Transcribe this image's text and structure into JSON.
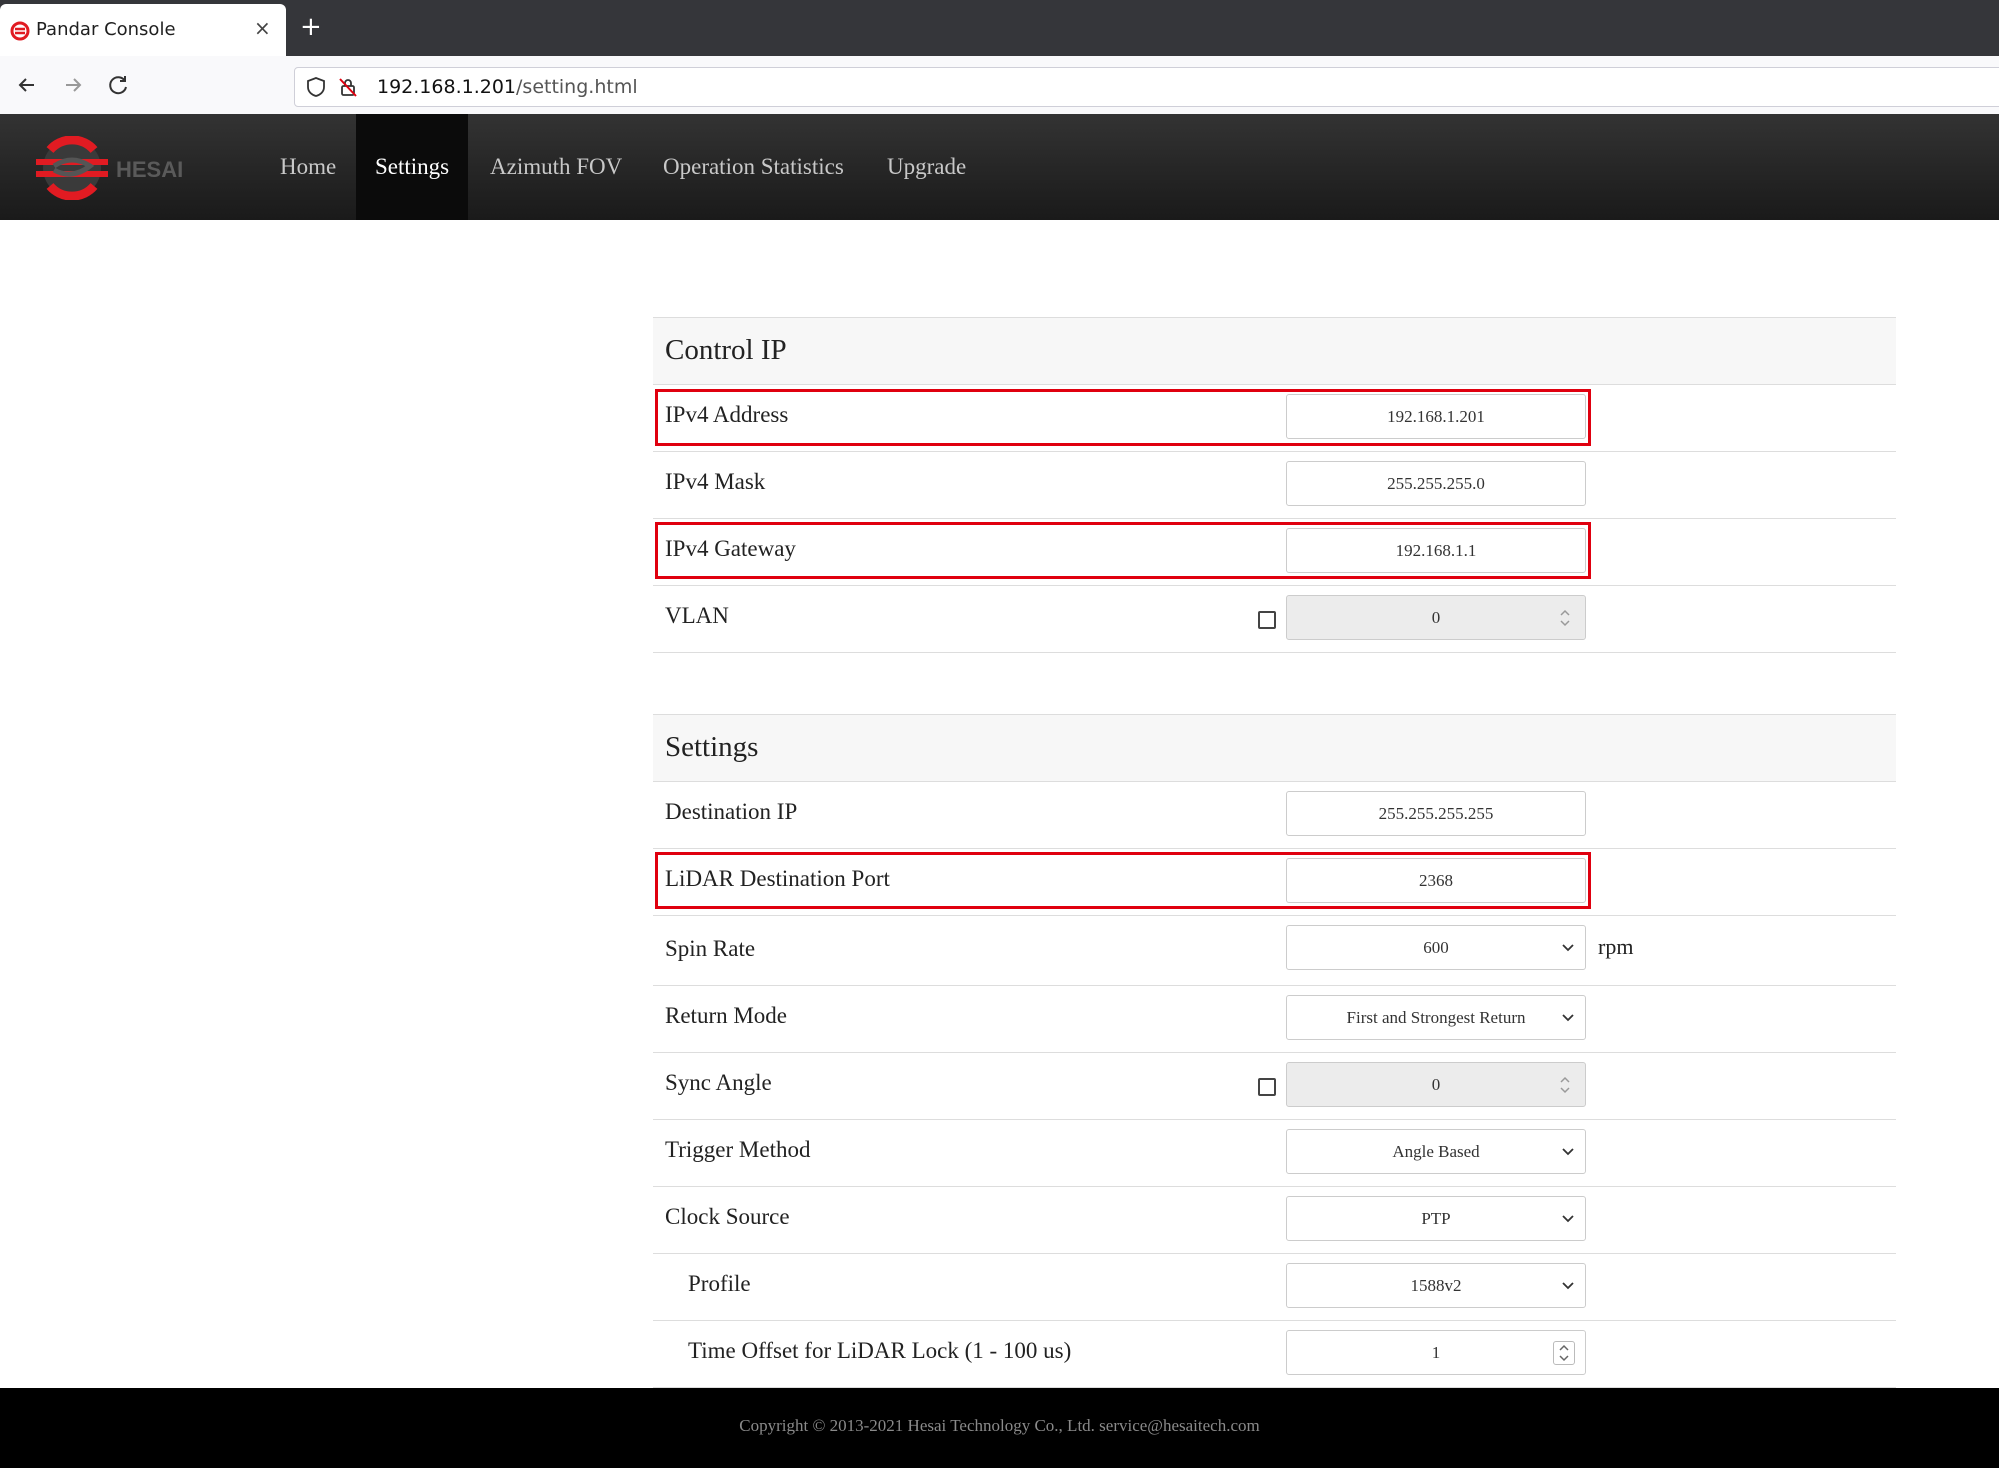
{
  "browser": {
    "tab_title": "Pandar Console",
    "close_glyph": "×",
    "new_tab_glyph": "+",
    "url_host": "192.168.1.201",
    "url_path": "/setting.html"
  },
  "header": {
    "logo_text": "HESAI",
    "menu": [
      {
        "label": "Home",
        "active": false
      },
      {
        "label": "Settings",
        "active": true
      },
      {
        "label": "Azimuth FOV",
        "active": false
      },
      {
        "label": "Operation Statistics",
        "active": false
      },
      {
        "label": "Upgrade",
        "active": false
      }
    ]
  },
  "control_ip": {
    "title": "Control IP",
    "ipv4_address": {
      "label": "IPv4 Address",
      "value": "192.168.1.201"
    },
    "ipv4_mask": {
      "label": "IPv4 Mask",
      "value": "255.255.255.0"
    },
    "ipv4_gateway": {
      "label": "IPv4 Gateway",
      "value": "192.168.1.1"
    },
    "vlan": {
      "label": "VLAN",
      "value": "0",
      "enabled": false
    }
  },
  "settings": {
    "title": "Settings",
    "destination_ip": {
      "label": "Destination IP",
      "value": "255.255.255.255"
    },
    "lidar_port": {
      "label": "LiDAR Destination Port",
      "value": "2368"
    },
    "spin_rate": {
      "label": "Spin Rate",
      "value": "600",
      "unit": "rpm"
    },
    "return_mode": {
      "label": "Return Mode",
      "value": "First and Strongest Return"
    },
    "sync_angle": {
      "label": "Sync Angle",
      "value": "0",
      "enabled": false
    },
    "trigger_method": {
      "label": "Trigger Method",
      "value": "Angle Based"
    },
    "clock_source": {
      "label": "Clock Source",
      "value": "PTP"
    },
    "profile": {
      "label": "Profile",
      "value": "1588v2"
    },
    "time_offset": {
      "label": "Time Offset for LiDAR Lock (1 - 100 us)",
      "value": "1"
    }
  },
  "footer": {
    "copyright": "Copyright © 2013-2021 Hesai Technology Co., Ltd. service@hesaitech.com"
  },
  "colors": {
    "highlight": "#e0000f",
    "brand_red": "#e11b22"
  }
}
